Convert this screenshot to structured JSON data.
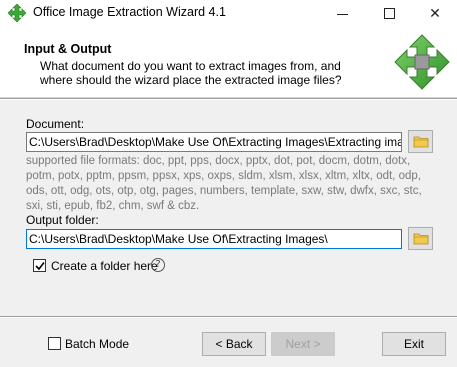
{
  "window": {
    "title": "Office Image Extraction Wizard 4.1",
    "controls": {
      "minimize": "minimize",
      "maximize": "maximize",
      "close": "✕"
    }
  },
  "header": {
    "title": "Input & Output",
    "description": "What document do you want to extract images from, and where should the wizard place the extracted image files?"
  },
  "document": {
    "label": "Document:",
    "value": "C:\\Users\\Brad\\Desktop\\Make Use Of\\Extracting Images\\Extracting images fro",
    "formats_text": "supported file formats: doc, ppt, pps, docx, pptx, dot, pot, docm, dotm, dotx, potm, potx, pptm, ppsm, ppsx, xps, oxps, sldm, xlsm, xlsx, xltm, xltx, odt, odp, ods, ott, odg, ots, otp, otg, pages, numbers, template, sxw, stw, dwfx, sxc, stc, sxi, sti, epub, fb2, chm, swf & cbz."
  },
  "output": {
    "label": "Output folder:",
    "value": "C:\\Users\\Brad\\Desktop\\Make Use Of\\Extracting Images\\"
  },
  "create_folder": {
    "label": "Create a folder here",
    "checked": true,
    "help": "?"
  },
  "batch_mode": {
    "label": "Batch Mode",
    "checked": false
  },
  "buttons": {
    "back": "< Back",
    "next": "Next >",
    "exit": "Exit"
  },
  "colors": {
    "accent": "#0078d7",
    "logo_green": "#3ea836",
    "folder_yellow": "#f2c94c"
  }
}
